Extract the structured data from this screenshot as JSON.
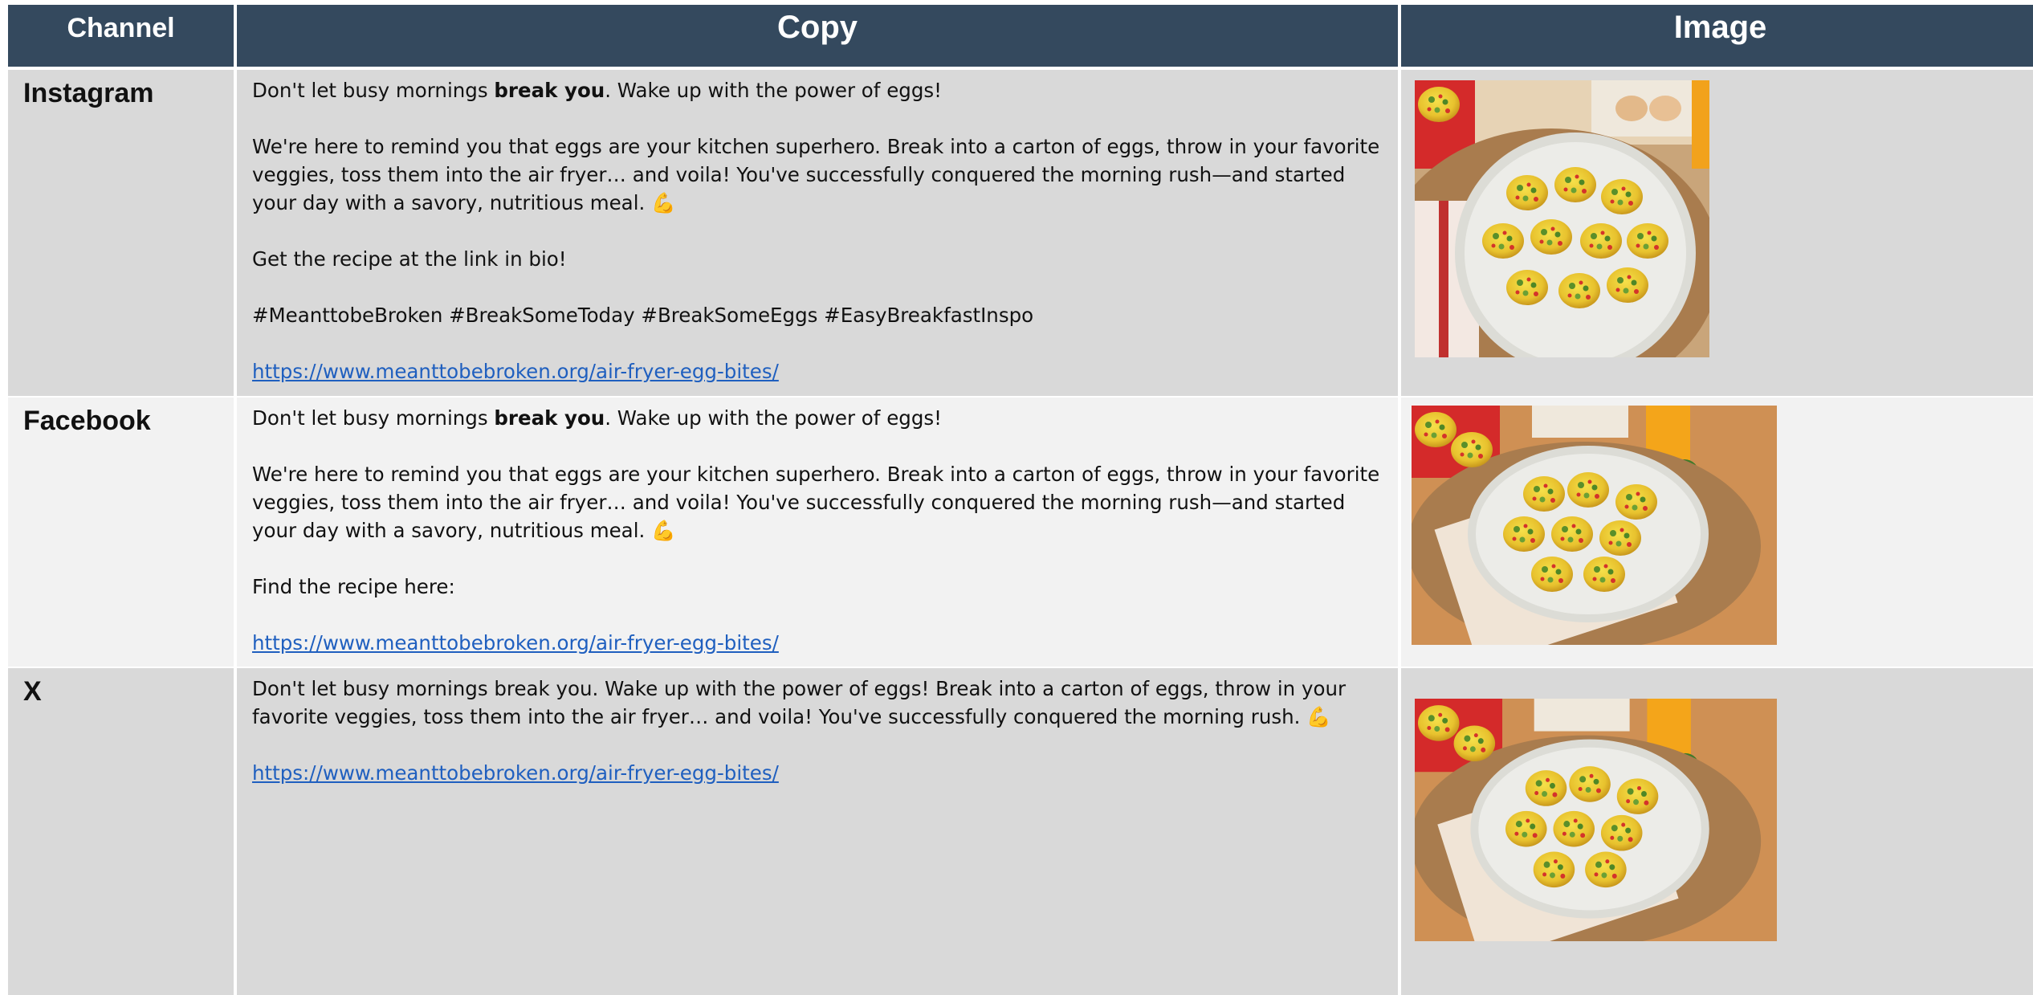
{
  "header": {
    "channel": "Channel",
    "copy": "Copy",
    "image": "Image"
  },
  "rows": [
    {
      "channel": "Instagram",
      "intro_before": "Don't let busy mornings ",
      "intro_bold": "break you",
      "intro_after": ". Wake up with the power of eggs!",
      "body": "We're here to remind you that eggs are your kitchen superhero. Break into a carton of eggs, throw in your favorite veggies, toss them into the air fryer… and voila! You've successfully conquered the morning rush—and started your day with a savory, nutritious meal.",
      "emoji": "💪",
      "cta": "Get the recipe at the link in bio!",
      "hashtags": "#MeanttobeBroken #BreakSomeToday #BreakSomeEggs #EasyBreakfastInspo",
      "link": "https://www.meanttobebroken.org/air-fryer-egg-bites/",
      "image": "egg-bites-plate-square-photo"
    },
    {
      "channel": "Facebook",
      "intro_before": "Don't let busy mornings ",
      "intro_bold": "break you",
      "intro_after": ". Wake up with the power of eggs!",
      "body": "We're here to remind you that eggs are your kitchen superhero. Break into a carton of eggs, throw in your favorite veggies, toss them into the air fryer… and voila! You've successfully conquered the morning rush—and started your day with a savory, nutritious meal.",
      "emoji": "💪",
      "cta": "Find the recipe here:",
      "link": "https://www.meanttobebroken.org/air-fryer-egg-bites/",
      "image": "egg-bites-plate-landscape-photo"
    },
    {
      "channel": "X",
      "body": "Don't let busy mornings break you. Wake up with the power of eggs! Break into a carton of eggs, throw in your favorite veggies, toss them into the air fryer… and voila! You've successfully conquered the morning rush.",
      "emoji": "💪",
      "link": "https://www.meanttobebroken.org/air-fryer-egg-bites/",
      "image": "egg-bites-plate-landscape-photo"
    }
  ],
  "colors": {
    "header_bg": "#34495e",
    "row_dark": "#d9d9d9",
    "row_light": "#f2f2f2",
    "link": "#1f5fbf"
  }
}
